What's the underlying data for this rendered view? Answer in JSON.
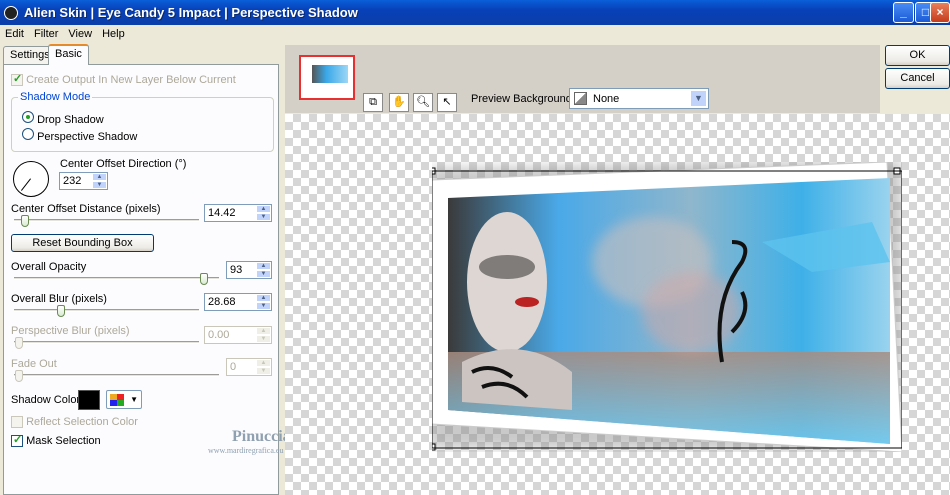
{
  "window": {
    "title": "Alien Skin | Eye Candy 5 Impact | Perspective Shadow"
  },
  "menu": [
    "Edit",
    "Filter",
    "View",
    "Help"
  ],
  "tabs": {
    "settings": "Settings",
    "basic": "Basic"
  },
  "panel": {
    "create_output": "Create Output In New Layer Below Current",
    "shadow_mode": {
      "legend": "Shadow Mode",
      "drop": "Drop Shadow",
      "perspective": "Perspective Shadow"
    },
    "center_offset_direction": {
      "label": "Center Offset Direction (°)",
      "value": "232"
    },
    "center_offset_distance": {
      "label": "Center Offset Distance (pixels)",
      "value": "14.42"
    },
    "reset_button": "Reset Bounding Box",
    "overall_opacity": {
      "label": "Overall Opacity",
      "value": "93"
    },
    "overall_blur": {
      "label": "Overall Blur (pixels)",
      "value": "28.68"
    },
    "perspective_blur": {
      "label": "Perspective Blur (pixels)",
      "value": "0.00"
    },
    "fade_out": {
      "label": "Fade Out",
      "value": "0"
    },
    "shadow_color": {
      "label": "Shadow Color",
      "color": "#000000"
    },
    "reflect_selection": "Reflect Selection Color",
    "mask_selection": "Mask Selection"
  },
  "preview": {
    "background_label": "Preview Background:",
    "background_value": "None"
  },
  "buttons": {
    "ok": "OK",
    "cancel": "Cancel"
  },
  "watermark": {
    "name": "Pinuccia",
    "site": "www.mardiregrafica.eu"
  }
}
